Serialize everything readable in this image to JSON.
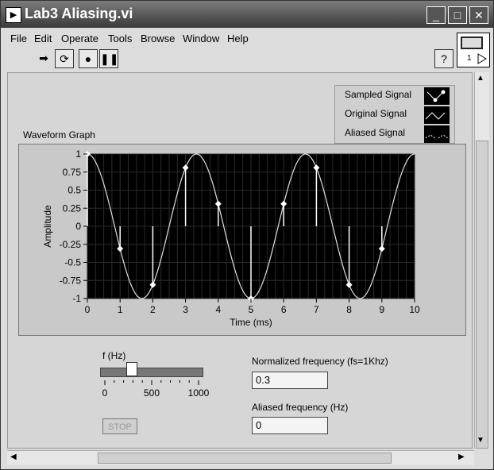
{
  "window": {
    "title": "Lab3 Aliasing.vi"
  },
  "menu": [
    "File",
    "Edit",
    "Operate",
    "Tools",
    "Browse",
    "Window",
    "Help"
  ],
  "legend": [
    {
      "label": "Sampled Signal"
    },
    {
      "label": "Original Signal"
    },
    {
      "label": "Aliased Signal"
    }
  ],
  "graph": {
    "title": "Waveform Graph"
  },
  "chart_data": {
    "type": "line",
    "xlabel": "Time (ms)",
    "ylabel": "Amplitude",
    "xlim": [
      0,
      10
    ],
    "ylim": [
      -1,
      1
    ],
    "xticks": [
      "0",
      "1",
      "2",
      "3",
      "4",
      "5",
      "6",
      "7",
      "8",
      "9",
      "10"
    ],
    "yticks": [
      "1",
      "0.75",
      "0.5",
      "0.25",
      "0",
      "-0.25",
      "-0.5",
      "-0.75",
      "-1"
    ],
    "series": [
      {
        "name": "Original Signal",
        "type": "line"
      },
      {
        "name": "Sampled Signal",
        "type": "scatter",
        "x": [
          0,
          1,
          2,
          3,
          4,
          5,
          6,
          7,
          8,
          9
        ],
        "y": [
          1,
          -0.31,
          -0.81,
          0.81,
          0.31,
          -1,
          0.31,
          0.81,
          -0.81,
          -0.31
        ]
      }
    ]
  },
  "controls": {
    "f_label": "f (Hz)",
    "slider_ticks": [
      "0",
      "500",
      "1000"
    ],
    "slider_value": 300,
    "norm_label": "Normalized frequency (fs=1Khz)",
    "norm_value": "0.3",
    "alias_label": "Aliased frequency (Hz)",
    "alias_value": "0",
    "stop_label": "STOP"
  }
}
